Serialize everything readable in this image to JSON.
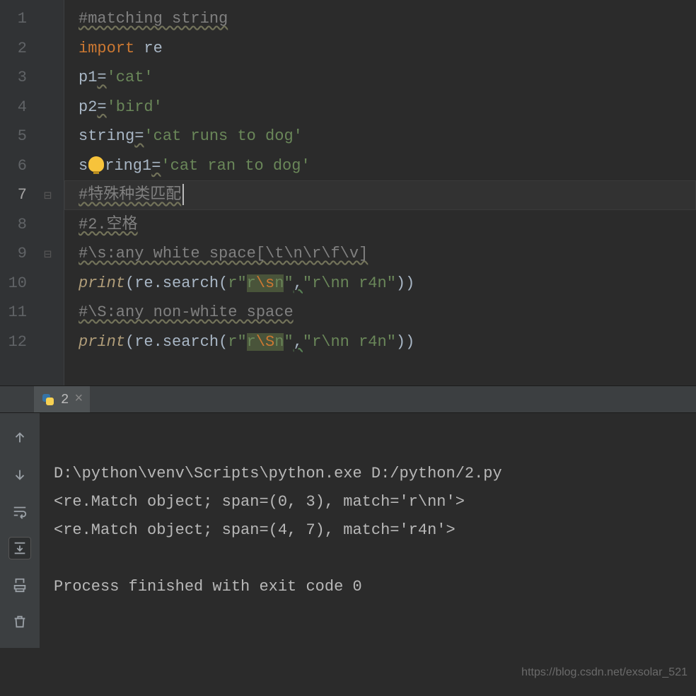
{
  "editor": {
    "lines": [
      "1",
      "2",
      "3",
      "4",
      "5",
      "6",
      "7",
      "8",
      "9",
      "10",
      "11",
      "12"
    ],
    "current_line": 7,
    "tokens": {
      "l1": {
        "comment": "#matching string"
      },
      "l2": {
        "kw": "import",
        "mod": "re"
      },
      "l3": {
        "v": "p1",
        "eq": "=",
        "s": "'cat'"
      },
      "l4": {
        "v": "p2",
        "eq": "=",
        "s": "'bird'"
      },
      "l5": {
        "v": "string",
        "eq": "=",
        "s": "'cat runs to dog'"
      },
      "l6": {
        "pre": "s",
        "post": "ring1",
        "eq": "=",
        "s": "'cat ran to dog'"
      },
      "l7": {
        "comment": "#特殊种类匹配"
      },
      "l8": {
        "comment": "#2.空格"
      },
      "l9": {
        "comment": "#\\s:any white space[\\t\\n\\r\\f\\v]"
      },
      "l10": {
        "fn": "print",
        "mod": "re",
        "m": "search",
        "q1": "r\"",
        "r": "r",
        "esc": "\\s",
        "n": "n",
        "q2": "\"",
        "c": ",",
        "s2": "\"r\\nn r4n\""
      },
      "l11": {
        "comment": "#\\S:any non-white space"
      },
      "l12": {
        "fn": "print",
        "mod": "re",
        "m": "search",
        "q1": "r\"",
        "r": "r",
        "esc": "\\S",
        "n": "n",
        "q2": "\"",
        "c": ",",
        "s2": "\"r\\nn r4n\""
      }
    }
  },
  "tab": {
    "label": "2",
    "close": "×"
  },
  "output": {
    "cmd": "D:\\python\\venv\\Scripts\\python.exe D:/python/2.py",
    "l1": "<re.Match object; span=(0, 3), match='r\\nn'>",
    "l2": "<re.Match object; span=(4, 7), match='r4n'>",
    "blank": "",
    "exit": "Process finished with exit code 0"
  },
  "watermark": "https://blog.csdn.net/exsolar_521"
}
